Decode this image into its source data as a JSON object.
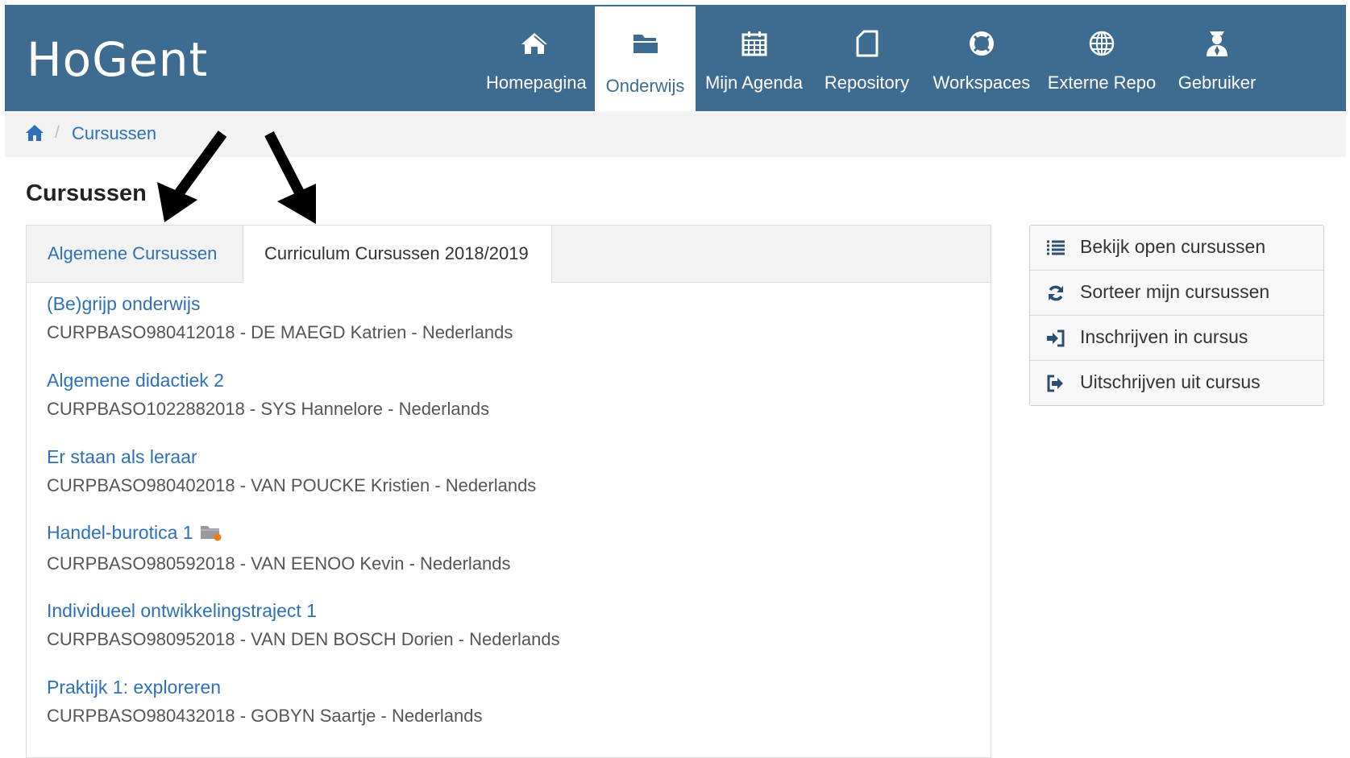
{
  "brand": {
    "name": "HoGent"
  },
  "nav": [
    {
      "label": "Homepagina",
      "icon": "home-icon",
      "active": false
    },
    {
      "label": "Onderwijs",
      "icon": "folder-open-icon",
      "active": true
    },
    {
      "label": "Mijn Agenda",
      "icon": "calendar-icon",
      "active": false
    },
    {
      "label": "Repository",
      "icon": "file-icon",
      "active": false
    },
    {
      "label": "Workspaces",
      "icon": "lifebuoy-icon",
      "active": false
    },
    {
      "label": "Externe Repo",
      "icon": "globe-icon",
      "active": false
    },
    {
      "label": "Gebruiker",
      "icon": "user-icon",
      "active": false
    }
  ],
  "breadcrumb": {
    "home_icon": "home-icon",
    "current": "Cursussen"
  },
  "page": {
    "title": "Cursussen"
  },
  "tabs": [
    {
      "label": "Algemene Cursussen",
      "active": false
    },
    {
      "label": "Curriculum Cursussen 2018/2019",
      "active": true
    }
  ],
  "courses": [
    {
      "title": "(Be)grijp onderwijs",
      "info": "CURPBASO980412018 - DE MAEGD Katrien - Nederlands"
    },
    {
      "title": "Algemene didactiek 2",
      "info": "CURPBASO1022882018 - SYS Hannelore - Nederlands"
    },
    {
      "title": "Er staan als leraar",
      "info": "CURPBASO980402018 - VAN POUCKE Kristien - Nederlands"
    },
    {
      "title": "Handel-burotica 1",
      "info": "CURPBASO980592018 - VAN EENOO Kevin - Nederlands",
      "badge_icon": "folder-notification-icon"
    },
    {
      "title": "Individueel ontwikkelingstraject 1",
      "info": "CURPBASO980952018 - VAN DEN BOSCH Dorien - Nederlands"
    },
    {
      "title": "Praktijk 1: exploreren",
      "info": "CURPBASO980432018 - GOBYN Saartje - Nederlands"
    }
  ],
  "actions": [
    {
      "label": "Bekijk open cursussen",
      "icon": "list-icon"
    },
    {
      "label": "Sorteer mijn cursussen",
      "icon": "refresh-icon"
    },
    {
      "label": "Inschrijven in cursus",
      "icon": "sign-in-icon"
    },
    {
      "label": "Uitschrijven uit cursus",
      "icon": "sign-out-icon"
    }
  ],
  "colors": {
    "navbar": "#3e6c90",
    "link": "#2e70b7",
    "badge_dot": "#f07d1a"
  }
}
